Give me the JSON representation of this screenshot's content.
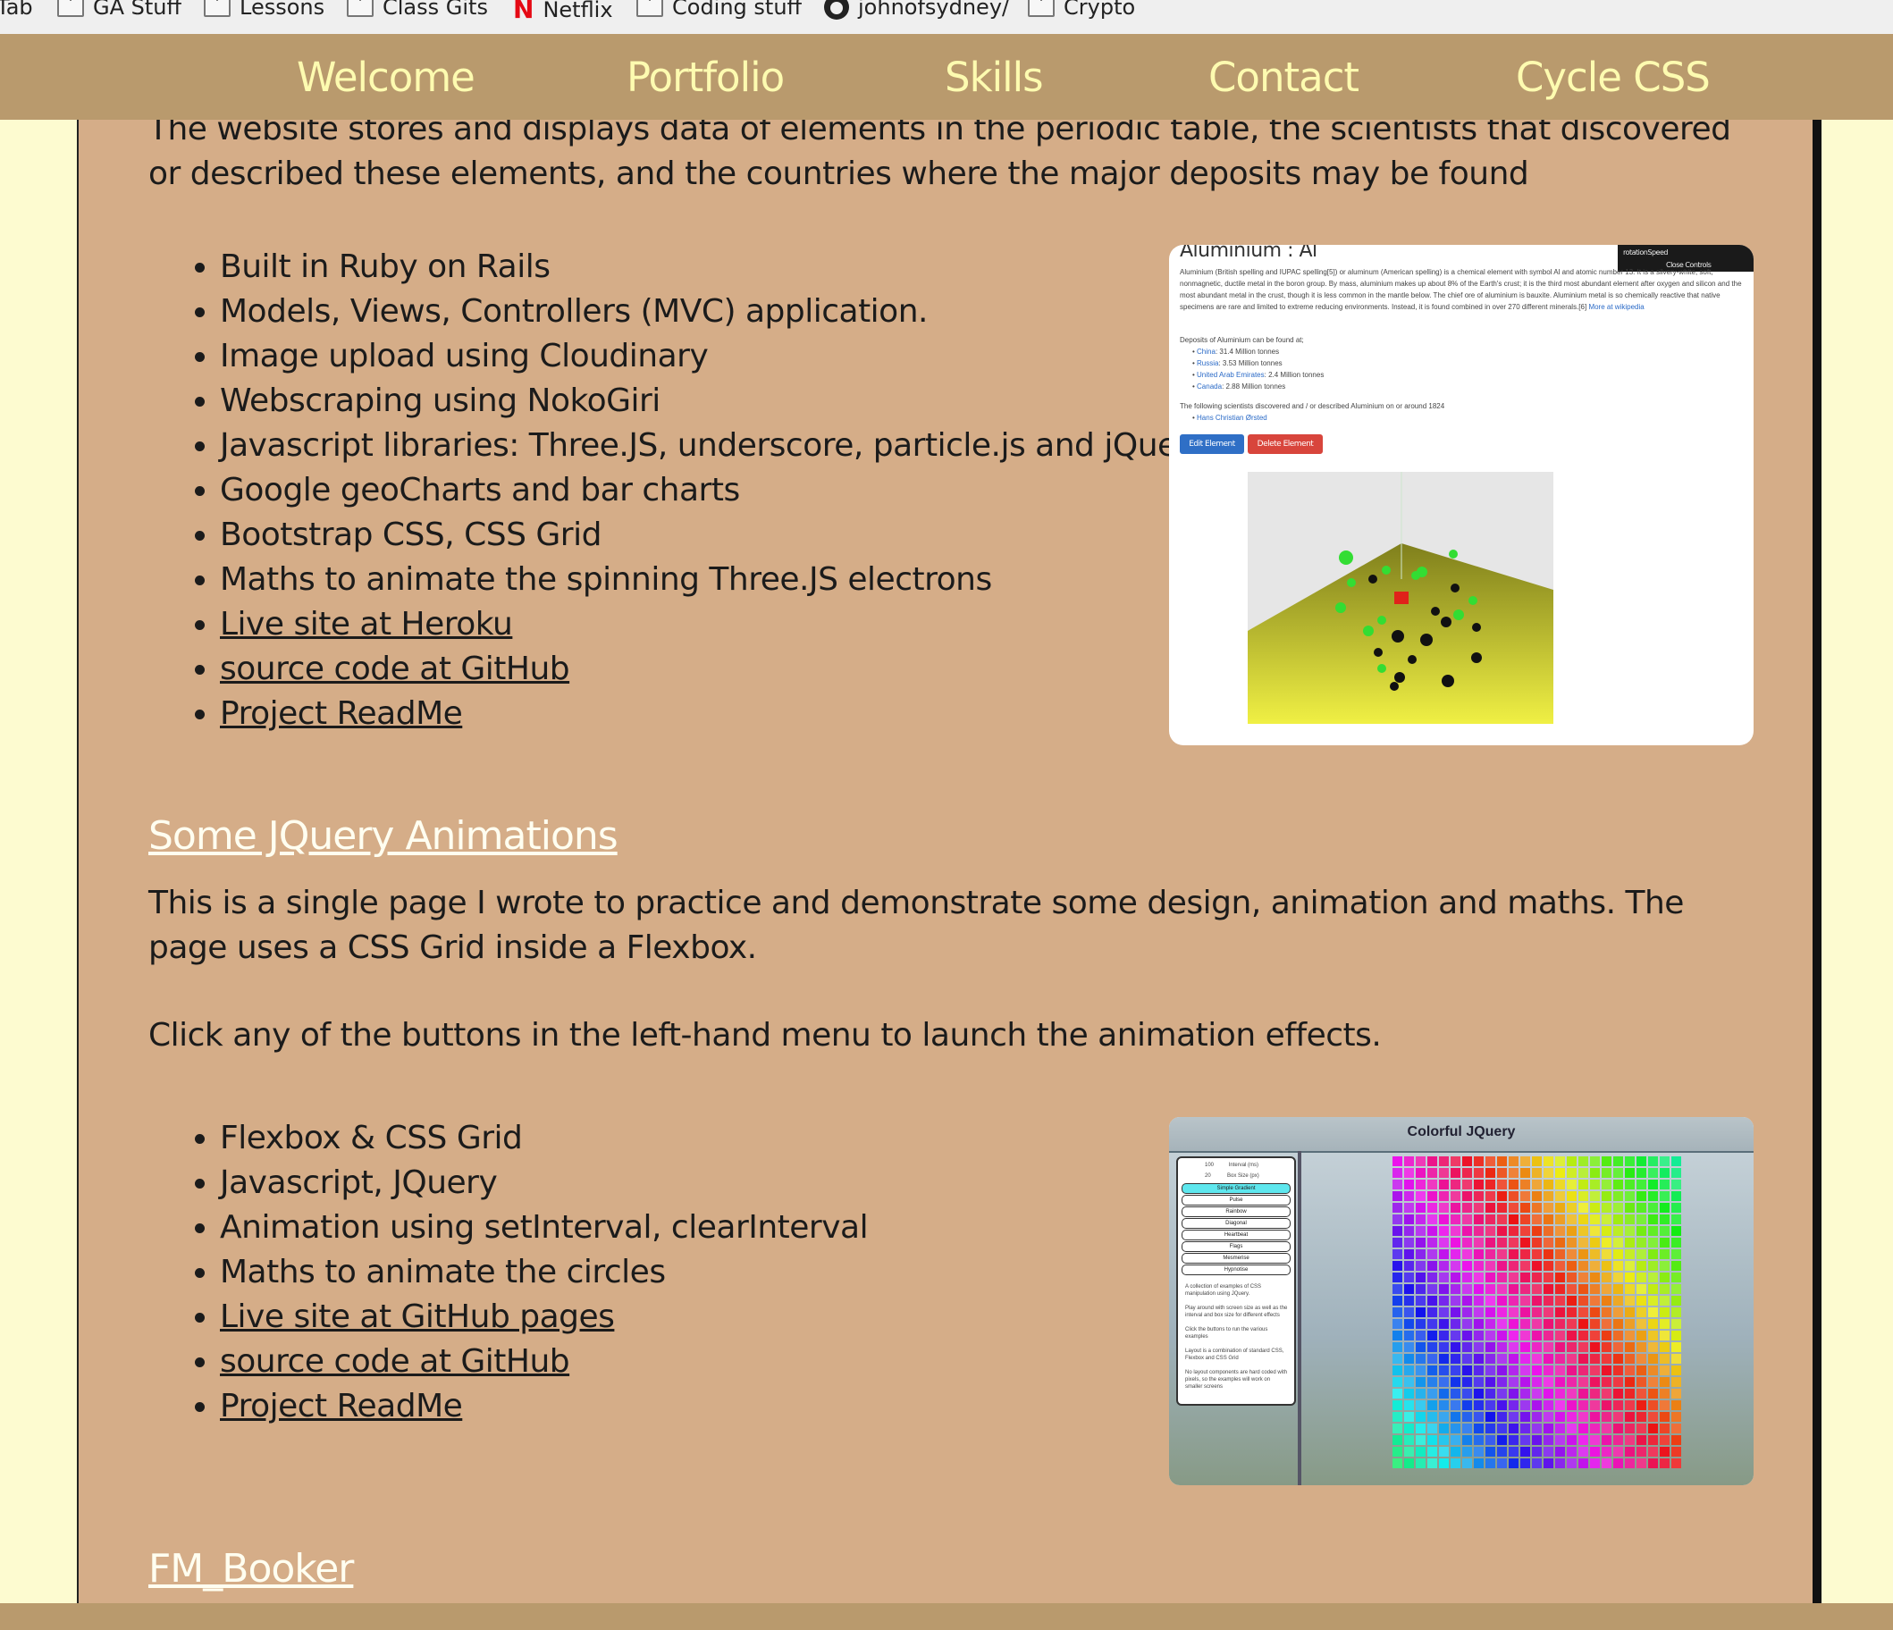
{
  "bookmarks": [
    {
      "label": "Tab",
      "icon": "none"
    },
    {
      "label": "GA Stuff",
      "icon": "folder-icon"
    },
    {
      "label": "Lessons",
      "icon": "folder-icon"
    },
    {
      "label": "Class Gits",
      "icon": "folder-icon"
    },
    {
      "label": "Netflix",
      "icon": "netflix-icon"
    },
    {
      "label": "Coding stuff",
      "icon": "folder-icon"
    },
    {
      "label": "johnofsydney/",
      "icon": "github-icon"
    },
    {
      "label": "Crypto",
      "icon": "folder-icon"
    }
  ],
  "nav": {
    "welcome": "Welcome",
    "portfolio": "Portfolio",
    "skills": "Skills",
    "contact": "Contact",
    "cycle": "Cycle CSS"
  },
  "periodic": {
    "intro": "The website stores and displays data of elements in the periodic table, the scientists that discovered or described these elements, and the countries where the major deposits may be found",
    "features": [
      "Built in Ruby on Rails",
      "Models, Views, Controllers (MVC) application.",
      "Image upload using Cloudinary",
      "Webscraping using NokoGiri",
      "Javascript libraries: Three.JS, underscore, particle.js and jQuery",
      "Google geoCharts and bar charts",
      "Bootstrap CSS, CSS Grid",
      "Maths to animate the spinning Three.JS electrons"
    ],
    "links": [
      "Live site at Heroku",
      "source code at GitHub",
      "Project ReadMe"
    ],
    "shot": {
      "title": "Aluminium : Al",
      "description": "Aluminium (British spelling and IUPAC spelling[5]) or aluminum (American spelling) is a chemical element with symbol Al and atomic number 13. It is a silvery-white, soft, nonmagnetic, ductile metal in the boron group. By mass, aluminium makes up about 8% of the Earth's crust; it is the third most abundant element after oxygen and silicon and the most abundant metal in the crust, though it is less common in the mantle below. The chief ore of aluminium is bauxite. Aluminium metal is so chemically reactive that native specimens are rare and limited to extreme reducing environments. Instead, it is found combined in over 270 different minerals.[6]",
      "more_link": "More at wikipedia",
      "deposits_heading": "Deposits of Aluminium can be found at;",
      "deposits": [
        {
          "country": "China",
          "amount": ": 31.4 Million tonnes"
        },
        {
          "country": "Russia",
          "amount": ": 3.53 Million tonnes"
        },
        {
          "country": "United Arab Emirates",
          "amount": ": 2.4 Million tonnes"
        },
        {
          "country": "Canada",
          "amount": ": 2.88 Million tonnes"
        }
      ],
      "scientists_heading": "The following scientists discovered and / or described Aluminium on or around 1824",
      "scientist": "Hans Christian Ørsted",
      "edit_label": "Edit Element",
      "delete_label": "Delete Element",
      "panel_label": "rotationSpeed",
      "panel_close": "Close Controls"
    }
  },
  "jquery": {
    "title": "Some JQuery Animations",
    "para1": "This is a single page I wrote to practice and demonstrate some design, animation and maths. The page uses a CSS Grid inside a Flexbox.",
    "para2": "Click any of the buttons in the left-hand menu to launch the animation effects.",
    "features": [
      "Flexbox & CSS Grid",
      "Javascript, JQuery",
      "Animation using setInterval, clearInterval",
      "Maths to animate the circles"
    ],
    "links": [
      "Live site at GitHub pages",
      "source code at GitHub",
      "Project ReadMe"
    ],
    "shot": {
      "title": "Colorful JQuery",
      "interval_value": "100",
      "interval_label": "Interval (ms)",
      "box_value": "20",
      "box_label": "Box Size (px)",
      "menu": [
        "Simple Gradient",
        "Pulse",
        "Rainbow",
        "Diagonal",
        "Heartbeat",
        "Flags",
        "Mesmerise",
        "Hypnotise"
      ],
      "notes": [
        "A collection of examples of CSS manipulation using JQuery.",
        "Play around with screen size as well as the interval and box size for different effects",
        "Click the buttons to run the various examples",
        "Layout is a combination of standard CSS, Flexbox and CSS Grid",
        "No layout components are hard coded with pixels, so the examples will work on smaller screens"
      ]
    }
  },
  "next": {
    "title": "FM_Booker"
  },
  "colors": {
    "nav": "#b99a6d",
    "nav_text": "#fdfbb0",
    "card": "#d5ad88",
    "page": "#fdfbd0"
  }
}
